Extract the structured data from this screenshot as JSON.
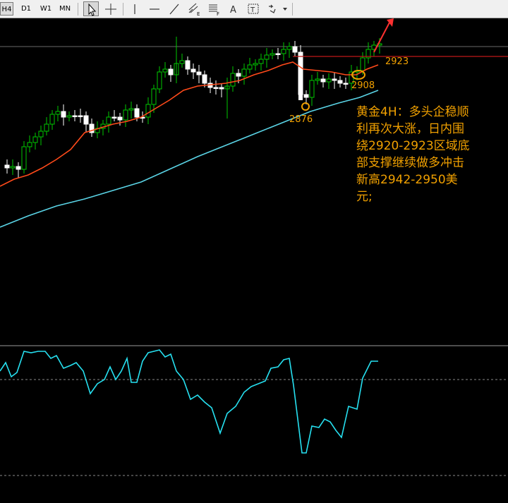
{
  "toolbar": {
    "timeframes": [
      "H4",
      "D1",
      "W1",
      "MN"
    ],
    "active_timeframe": "H4",
    "tools": [
      {
        "name": "cursor-icon",
        "active": true
      },
      {
        "name": "crosshair-icon",
        "active": false
      },
      {
        "name": "vertical-line-icon",
        "active": false
      },
      {
        "name": "horizontal-line-icon",
        "active": false
      },
      {
        "name": "trendline-icon",
        "active": false
      },
      {
        "name": "equidistant-channel-icon",
        "active": false
      },
      {
        "name": "fibonacci-icon",
        "active": false
      },
      {
        "name": "text-icon",
        "active": false
      },
      {
        "name": "text-label-icon",
        "active": false
      },
      {
        "name": "arrows-shapes-icon",
        "active": false
      }
    ],
    "text_tool_glyph": "A",
    "label_tool_glyph": "T",
    "fib_tool_sub": "F",
    "channel_tool_sub": "E"
  },
  "annotations": {
    "low_label": "2876",
    "support_label": "2908",
    "resistance_label": "2923"
  },
  "commentary": {
    "lines": [
      "黄金4H：多头企稳顺",
      "利再次大涨，日内围",
      "绕2920-2923区域底",
      "部支撑继续做多冲击",
      "新高2942-2950美",
      "元;"
    ]
  },
  "colors": {
    "background": "#000000",
    "bull_candle": "#00c800",
    "bear_candle": "#ffffff",
    "ma_fast": "#ff4a1a",
    "ma_slow": "#5ad4e6",
    "oscillator": "#26e0f0",
    "annotation": "#f0a000",
    "resistance_line": "#c01818",
    "arrow": "#ff3030"
  }
}
